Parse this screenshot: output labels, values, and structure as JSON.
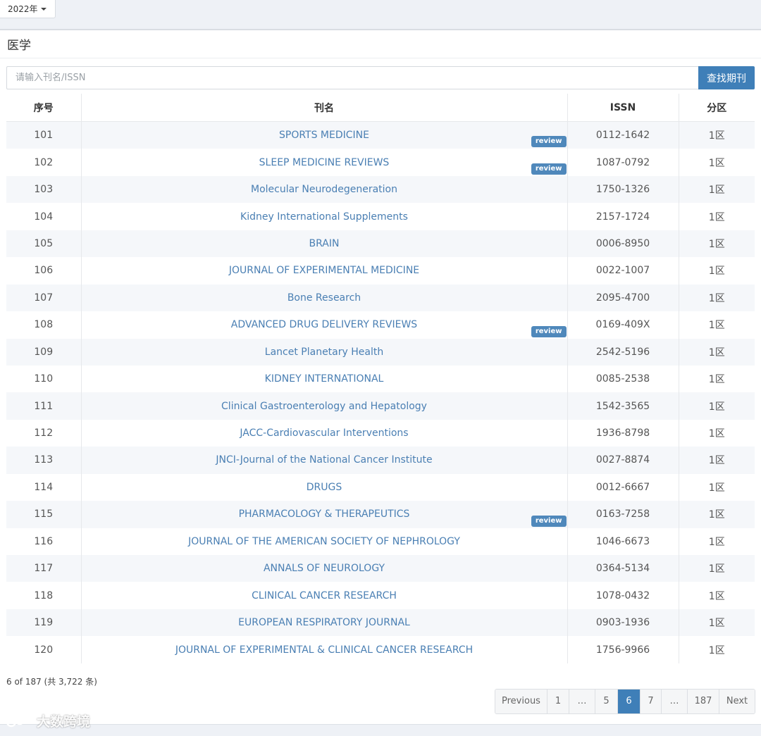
{
  "filter": {
    "year_label": "2022年"
  },
  "section": {
    "title": "医学"
  },
  "search": {
    "placeholder": "请输入刊名/ISSN",
    "button_label": "查找期刊"
  },
  "table": {
    "headers": {
      "index": "序号",
      "name": "刊名",
      "issn": "ISSN",
      "zone": "分区"
    },
    "rows": [
      {
        "index": "101",
        "name": "SPORTS MEDICINE",
        "review": "review",
        "issn": "0112-1642",
        "zone": "1区"
      },
      {
        "index": "102",
        "name": "SLEEP MEDICINE REVIEWS",
        "review": "review",
        "issn": "1087-0792",
        "zone": "1区"
      },
      {
        "index": "103",
        "name": "Molecular Neurodegeneration",
        "issn": "1750-1326",
        "zone": "1区"
      },
      {
        "index": "104",
        "name": "Kidney International Supplements",
        "issn": "2157-1724",
        "zone": "1区"
      },
      {
        "index": "105",
        "name": "BRAIN",
        "issn": "0006-8950",
        "zone": "1区"
      },
      {
        "index": "106",
        "name": "JOURNAL OF EXPERIMENTAL MEDICINE",
        "issn": "0022-1007",
        "zone": "1区"
      },
      {
        "index": "107",
        "name": "Bone Research",
        "issn": "2095-4700",
        "zone": "1区"
      },
      {
        "index": "108",
        "name": "ADVANCED DRUG DELIVERY REVIEWS",
        "review": "review",
        "issn": "0169-409X",
        "zone": "1区"
      },
      {
        "index": "109",
        "name": "Lancet Planetary Health",
        "issn": "2542-5196",
        "zone": "1区"
      },
      {
        "index": "110",
        "name": "KIDNEY INTERNATIONAL",
        "issn": "0085-2538",
        "zone": "1区"
      },
      {
        "index": "111",
        "name": "Clinical Gastroenterology and Hepatology",
        "issn": "1542-3565",
        "zone": "1区"
      },
      {
        "index": "112",
        "name": "JACC-Cardiovascular Interventions",
        "issn": "1936-8798",
        "zone": "1区"
      },
      {
        "index": "113",
        "name": "JNCI-Journal of the National Cancer Institute",
        "issn": "0027-8874",
        "zone": "1区"
      },
      {
        "index": "114",
        "name": "DRUGS",
        "issn": "0012-6667",
        "zone": "1区"
      },
      {
        "index": "115",
        "name": "PHARMACOLOGY & THERAPEUTICS",
        "review": "review",
        "issn": "0163-7258",
        "zone": "1区"
      },
      {
        "index": "116",
        "name": "JOURNAL OF THE AMERICAN SOCIETY OF NEPHROLOGY",
        "issn": "1046-6673",
        "zone": "1区"
      },
      {
        "index": "117",
        "name": "ANNALS OF NEUROLOGY",
        "issn": "0364-5134",
        "zone": "1区"
      },
      {
        "index": "118",
        "name": "CLINICAL CANCER RESEARCH",
        "issn": "1078-0432",
        "zone": "1区"
      },
      {
        "index": "119",
        "name": "EUROPEAN RESPIRATORY JOURNAL",
        "issn": "0903-1936",
        "zone": "1区"
      },
      {
        "index": "120",
        "name": "JOURNAL OF EXPERIMENTAL & CLINICAL CANCER RESEARCH",
        "issn": "1756-9966",
        "zone": "1区"
      }
    ]
  },
  "pagination": {
    "summary": "6 of 187 (共 3,722 条)",
    "items": [
      {
        "label": "Previous",
        "active": false
      },
      {
        "label": "1",
        "active": false
      },
      {
        "label": "…",
        "active": false
      },
      {
        "label": "5",
        "active": false
      },
      {
        "label": "6",
        "active": true
      },
      {
        "label": "7",
        "active": false
      },
      {
        "label": "…",
        "active": false
      },
      {
        "label": "187",
        "active": false
      },
      {
        "label": "Next",
        "active": false
      }
    ]
  },
  "watermark": {
    "text": "大数跨境"
  },
  "colors": {
    "accent": "#3f7fb8",
    "link": "#4a7fb3",
    "badge": "#4f88bb",
    "stripe": "#f5f7fa"
  }
}
